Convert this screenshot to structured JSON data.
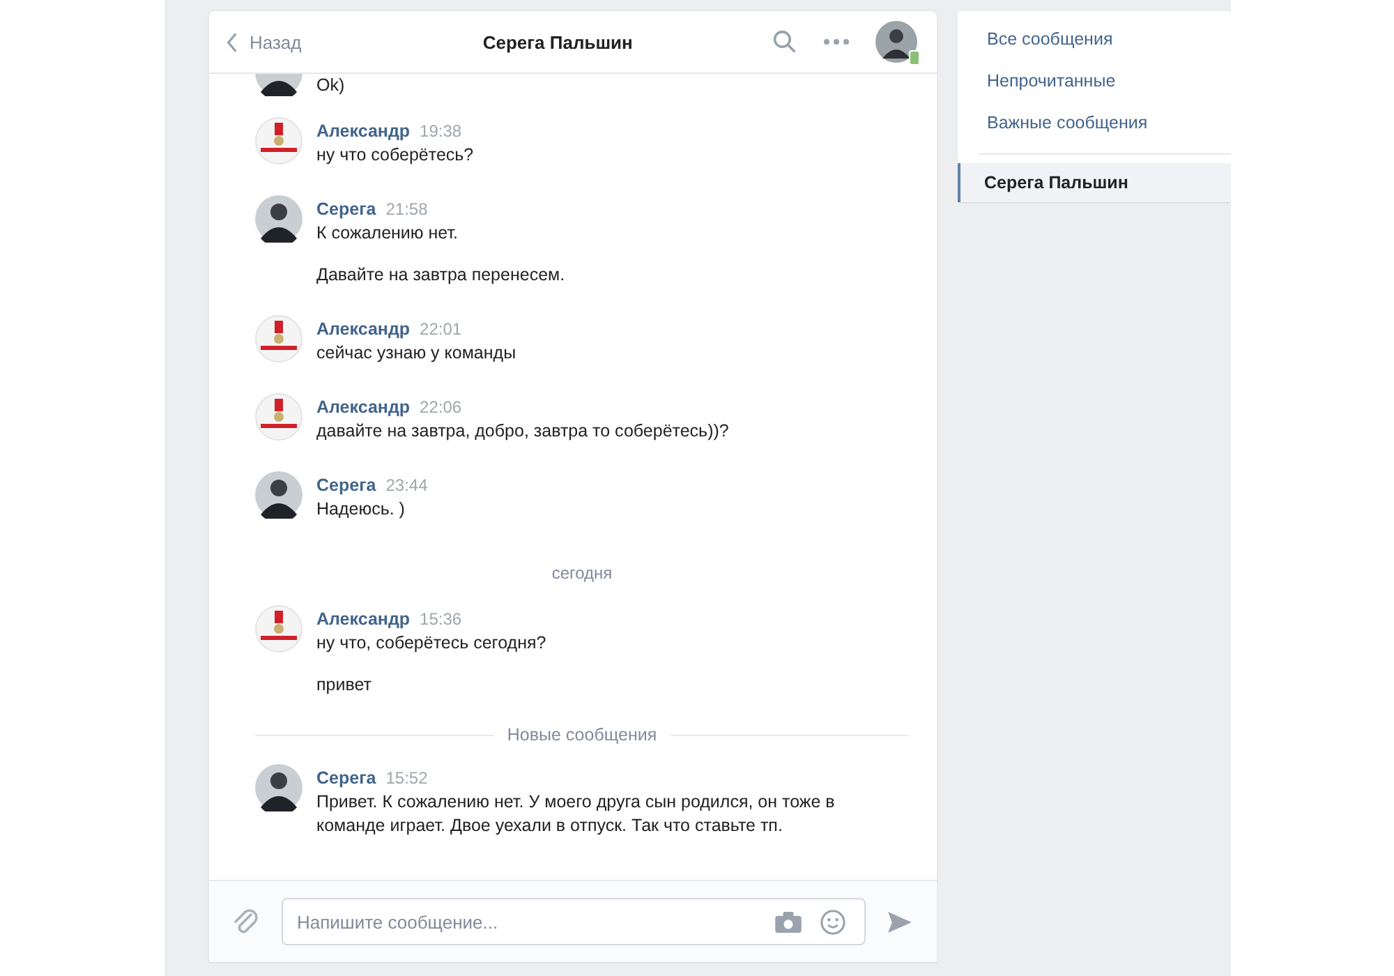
{
  "header": {
    "back": "Назад",
    "title": "Серега Пальшин",
    "contact_online": true
  },
  "feed": [
    {
      "kind": "partial",
      "avatar": {
        "kind": "photo"
      },
      "texts": [
        "Ok)"
      ]
    },
    {
      "kind": "message",
      "avatar": {
        "kind": "emblem"
      },
      "author": "Александр",
      "time": "19:38",
      "texts": [
        "ну что соберётесь?"
      ]
    },
    {
      "kind": "message",
      "avatar": {
        "kind": "photo"
      },
      "author": "Серега",
      "time": "21:58",
      "texts": [
        "К сожалению нет.",
        "Давайте на завтра перенесем."
      ]
    },
    {
      "kind": "message",
      "avatar": {
        "kind": "emblem"
      },
      "author": "Александр",
      "time": "22:01",
      "texts": [
        "сейчас узнаю у команды"
      ]
    },
    {
      "kind": "message",
      "avatar": {
        "kind": "emblem"
      },
      "author": "Александр",
      "time": "22:06",
      "texts": [
        "давайте на завтра, добро, завтра то соберётесь))?"
      ]
    },
    {
      "kind": "message",
      "avatar": {
        "kind": "photo"
      },
      "author": "Серега",
      "time": "23:44",
      "texts": [
        "Надеюсь. )"
      ]
    },
    {
      "kind": "date",
      "text": "сегодня"
    },
    {
      "kind": "message",
      "avatar": {
        "kind": "emblem"
      },
      "author": "Александр",
      "time": "15:36",
      "texts": [
        "ну что, соберётесь сегодня?",
        "привет"
      ]
    },
    {
      "kind": "divider",
      "text": "Новые сообщения"
    },
    {
      "kind": "message",
      "avatar": {
        "kind": "photo"
      },
      "author": "Серега",
      "time": "15:52",
      "texts": [
        "Привет. К сожалению нет. У моего друга сын родился, он тоже в команде играет. Двое уехали в отпуск. Так что ставьте тп."
      ]
    }
  ],
  "composer": {
    "placeholder": "Напишите сообщение..."
  },
  "menu": {
    "filters": [
      {
        "label": "Все сообщения",
        "selected": false
      },
      {
        "label": "Непрочитанные",
        "selected": false
      },
      {
        "label": "Важные сообщения",
        "selected": false
      }
    ],
    "chats": [
      {
        "label": "Серега Пальшин",
        "selected": true
      }
    ]
  }
}
